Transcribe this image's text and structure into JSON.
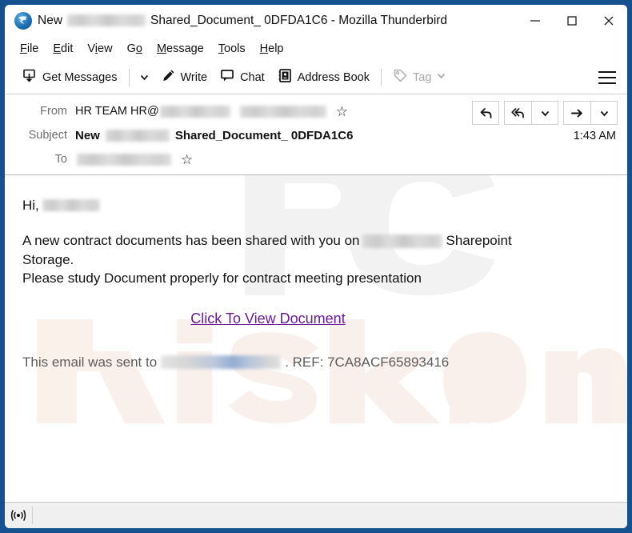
{
  "window": {
    "app_icon": "thunderbird-icon",
    "title_prefix": "New",
    "title_redacted": "[redacted]",
    "title_suffix": "Shared_Document_ 0DFDA1C6 - Mozilla Thunderbird",
    "controls": {
      "minimize": "minimize-icon",
      "maximize": "maximize-icon",
      "close": "close-icon"
    },
    "border_color": "#15518f"
  },
  "menu": {
    "items": [
      {
        "label": "File",
        "accesskey": "F"
      },
      {
        "label": "Edit",
        "accesskey": "E"
      },
      {
        "label": "View",
        "accesskey": "V"
      },
      {
        "label": "Go",
        "accesskey": "G"
      },
      {
        "label": "Message",
        "accesskey": "M"
      },
      {
        "label": "Tools",
        "accesskey": "T"
      },
      {
        "label": "Help",
        "accesskey": "H"
      }
    ]
  },
  "toolbar": {
    "get_messages": "Get Messages",
    "write": "Write",
    "chat": "Chat",
    "address_book": "Address Book",
    "tag": "Tag",
    "tag_disabled": true,
    "app_menu": "hamburger-menu-icon"
  },
  "message_header": {
    "from_label": "From",
    "from_value": "HR TEAM HR@",
    "from_redacted_1": "[redacted-domain]",
    "from_redacted_2": "[redacted-email]",
    "subject_label": "Subject",
    "subject_prefix": "New",
    "subject_redacted": "[redacted]",
    "subject_suffix": "Shared_Document_ 0DFDA1C6",
    "to_label": "To",
    "to_redacted": "[redacted-recipient]",
    "time": "1:43 AM",
    "star_glyph": "☆",
    "actions": {
      "reply": "reply-icon",
      "reply_all": "reply-all-icon",
      "reply_all_more": "chevron-down-icon",
      "forward": "forward-icon",
      "forward_more": "chevron-down-icon"
    }
  },
  "body": {
    "greeting": "Hi,",
    "greeting_redacted": "[redacted-name]",
    "para1_before": "A new contract documents has been shared with you on",
    "para1_redacted": "[redacted-domain]",
    "para1_after": "Sharepoint",
    "para1_line2": "Storage.",
    "para2": "Please study Document properly for contract meeting presentation",
    "link_text": "Click To View Document",
    "link_color": "#6a1b9a",
    "footer_before": "This email was sent to",
    "footer_redacted": "[redacted-email]",
    "footer_after": ". REF: 7CA8ACF65893416",
    "reference_number": "7CA8ACF65893416",
    "watermark_text": "PC risk.com"
  },
  "status_bar": {
    "icon": "broadcast-icon",
    "text": ""
  }
}
